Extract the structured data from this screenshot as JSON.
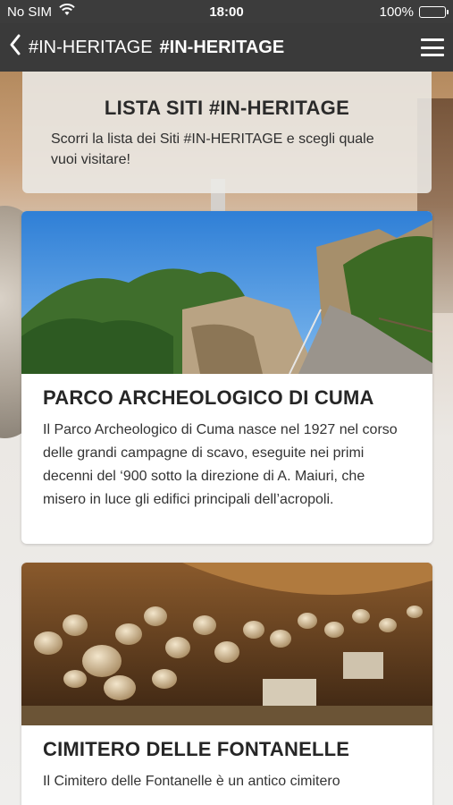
{
  "status_bar": {
    "carrier": "No SIM",
    "time": "18:00",
    "battery": "100%",
    "battery_color": "#4cd964"
  },
  "nav": {
    "back_icon": "chevron-left-icon",
    "title_regular": "#IN-HERITAGE",
    "title_bold": "#IN-HERITAGE",
    "menu_icon": "hamburger-menu-icon"
  },
  "header": {
    "title": "LISTA SITI #IN-HERITAGE",
    "subtitle": "Scorri la lista dei Siti #IN-HERITAGE e scegli quale vuoi visitare!"
  },
  "sites": [
    {
      "title": "PARCO ARCHEOLOGICO DI CUMA",
      "description": "Il Parco Archeologico di Cuma nasce nel 1927 nel corso delle grandi campagne di scavo, eseguite nei primi decenni del ‘900 sotto la direzione di A. Maiuri, che misero in luce gli edifici principali dell’acropoli."
    },
    {
      "title": "CIMITERO DELLE FONTANELLE",
      "description": "Il Cimitero delle Fontanelle è un antico cimitero"
    }
  ]
}
